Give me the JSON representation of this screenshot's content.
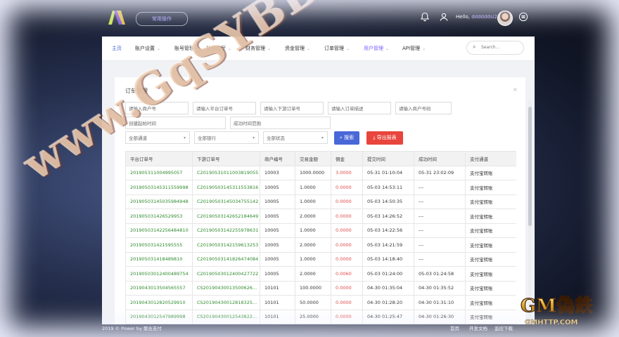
{
  "header": {
    "switch_label": "常用操作",
    "greeting_prefix": "Hello, ",
    "username": "ddddddsi2"
  },
  "nav": {
    "items": [
      {
        "label": "主页",
        "caret": false
      },
      {
        "label": "账户设置",
        "caret": true
      },
      {
        "label": "账号管理",
        "caret": false
      },
      {
        "label": "抢单大厅",
        "caret": true
      },
      {
        "label": "财务管理",
        "caret": true
      },
      {
        "label": "资金管理",
        "caret": true
      },
      {
        "label": "订单管理",
        "caret": true
      },
      {
        "label": "用户管理",
        "caret": true
      },
      {
        "label": "API管理",
        "caret": true
      }
    ],
    "search_placeholder": "Search..."
  },
  "card": {
    "title": "订单管理",
    "filters": {
      "merchant_no": "请输入商户号",
      "platform_order": "请输入平台订单号",
      "downstream_order": "请输入下游订单号",
      "order_desc": "请输入订单描述",
      "extra_code": "请输入商户号码",
      "created_start": "创建起始时间",
      "success_range": "成功时间范围",
      "channel": "全部通道",
      "bank": "全部银行",
      "status": "全部状态"
    },
    "search_label": "搜索",
    "export_label": "导出报表"
  },
  "table": {
    "columns": [
      "平台订单号",
      "下游订单号",
      "商户编号",
      "交易金额",
      "佣金",
      "提交时间",
      "成功时间",
      "支付通道"
    ],
    "rows": [
      [
        "201905311004995057",
        "C20190531011003819055",
        "10003",
        "1000.0000",
        "3.0000",
        "05-31 01:10:04",
        "05-31 23:02:09",
        "支付宝转账"
      ],
      [
        "201905031453115599​98",
        "C20190503145311553816",
        "10005",
        "1.0000",
        "0.0000",
        "05-03 14:53:11",
        "---",
        "支付宝转账"
      ],
      [
        "201905031450359849​48",
        "C20190503145034755142",
        "10005",
        "1.0000",
        "0.0000",
        "05-03 14:50:35",
        "---",
        "支付宝转账"
      ],
      [
        "201905031426529953",
        "C20190503142652184649",
        "10005",
        "2.0000",
        "0.0000",
        "05-03 14:26:52",
        "---",
        "支付宝转账"
      ],
      [
        "201905031422564848​10",
        "C20190503142255978631",
        "10005",
        "1.0000",
        "0.0000",
        "05-03 14:22:56",
        "---",
        "支付宝转账"
      ],
      [
        "201905031421595555",
        "C20190503142159613253",
        "10005",
        "2.0000",
        "0.0000",
        "05-03 14:21:59",
        "---",
        "支付宝转账"
      ],
      [
        "201905031418489810",
        "C20190503141826474084",
        "10005",
        "1.0000",
        "0.0000",
        "05-03 14:18:40",
        "---",
        "支付宝转账"
      ],
      [
        "201905030124004897​54",
        "C20190503012400427722",
        "10005",
        "2.0000",
        "0.0060",
        "05-03 01:24:00",
        "05-03 01:24:58",
        "支付宝转账"
      ],
      [
        "201904301350456555​7",
        "CS20190430013500626...",
        "10101",
        "100.0000",
        "0.0000",
        "04-30 01:35:04",
        "04-30 01:35:52",
        "支付宝转账"
      ],
      [
        "201904301282052991​0",
        "CS20190430012818325...",
        "10101",
        "50.0000",
        "0.0000",
        "04-30 01:28:20",
        "04-30 01:31:10",
        "支付宝转账"
      ],
      [
        "201904301254798999​8",
        "CS20190430012543822...",
        "10101",
        "25.0000",
        "0.0000",
        "04-30 01:25:47",
        "04-30 01:26:30",
        "支付宝转账"
      ]
    ]
  },
  "footer": {
    "copyright": "2019 © Power by 聚合支付",
    "links": [
      "首页",
      "开发文档",
      "监控下载"
    ]
  },
  "watermark": {
    "text": "www.GqSYBB.com",
    "badge_text_top": "GM偽鉄",
    "badge_text_bottom": "GMHTTP.COM"
  },
  "colors": {
    "accent": "#4a67d8",
    "danger": "#e8453c",
    "link_green": "#2e8b2e",
    "fee_red": "#e04848",
    "nav_active": "#7b61ff"
  }
}
